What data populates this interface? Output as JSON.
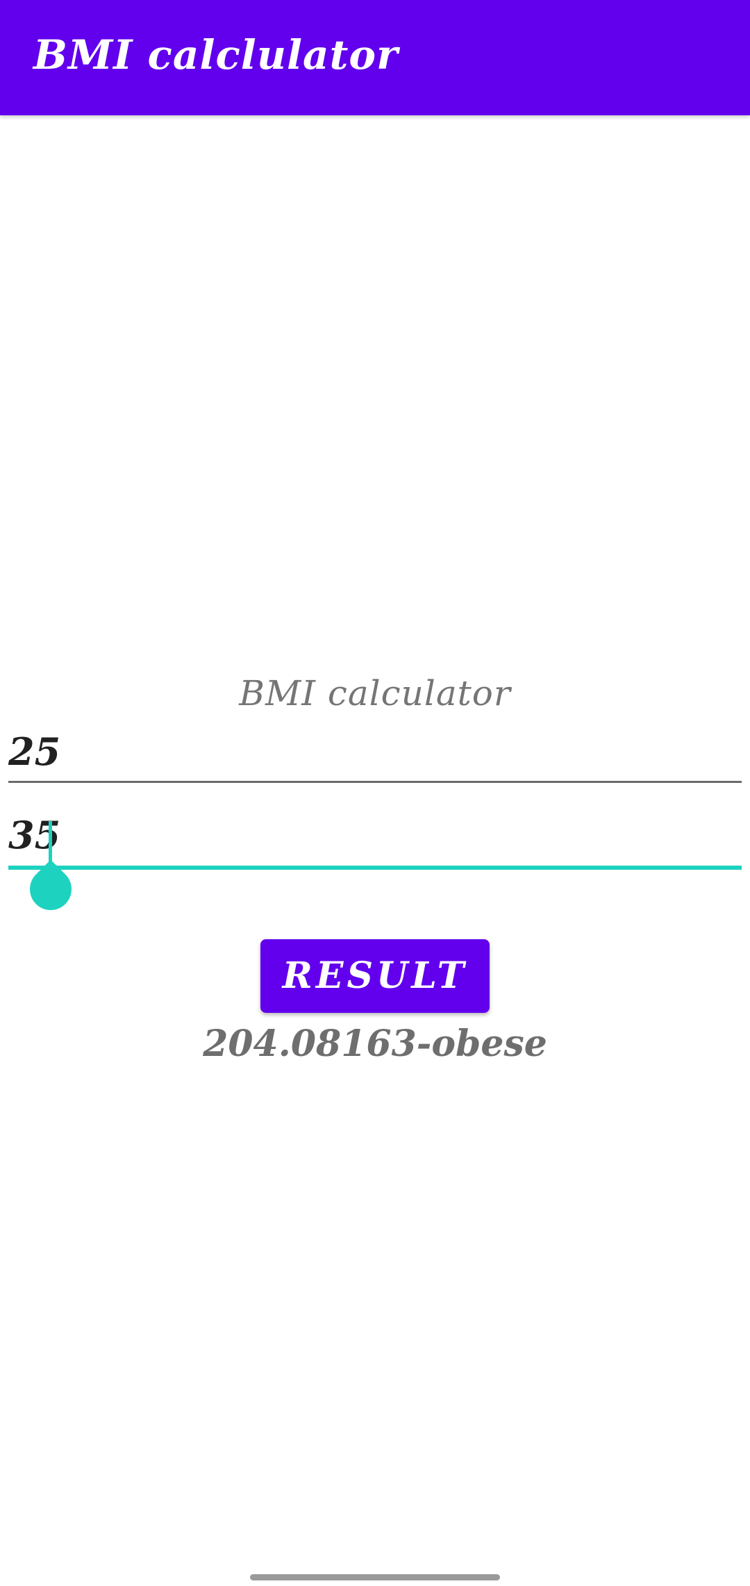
{
  "app_bar": {
    "title": "BMI calclulator"
  },
  "main": {
    "title": "BMI calculator",
    "field_1": {
      "value": "25"
    },
    "field_2": {
      "value": "35"
    },
    "result_button_label": "RESULT",
    "result_text": "204.08163-obese"
  },
  "colors": {
    "primary": "#6200EE",
    "accent": "#1ED2C0",
    "background": "#FFFFFF"
  }
}
